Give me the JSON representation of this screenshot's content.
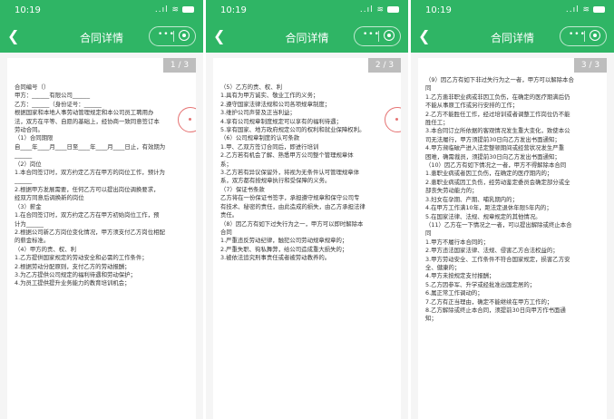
{
  "phones": [
    {
      "time": "10:19",
      "signal": "..ıl",
      "title": "合同详情",
      "capsule_dots": "•••",
      "pager": "1 / 3",
      "lines": [
        "",
        "合同编号（）",
        "甲方：______有限公司______",
        "乙方：______（身份证号：______",
        "根据国家和本地人事劳动管理规定和本公司员工聘用办",
        "法，双方在平等、自愿的基础上，经协商一致同意签订本",
        "劳动合同。",
        "（1）合同期限",
        "自____年____月____日至____年____月____日止，有效期为",
        "______",
        "（2）岗位",
        "1.本合同签订时，双方约定乙方在甲方的岗位工作，预计为",
        "______",
        "2.根据甲方发展需要，任何乙方可以提出岗位调换要求，",
        "经双方同意后调换新的岗位",
        "（3）薪金",
        "1.在合同签订时，双方约定乙方在甲方初始岗位工作，预",
        "计为______",
        "2.根据公司新乙方岗位变化情况，甲方须支付乙方岗位相配",
        "的薪金标准。",
        "（4）甲方的责、权、利",
        "1.乙方提供国家规定的劳动安全和必需的工作条件；",
        "2.根据劳动分配原则，支付乙方的劳动报酬；",
        "3.为乙方提供公司规定的福利待遇和劳动保护；",
        "4.为员工提供提升业务能力的教育培训机会；"
      ]
    },
    {
      "time": "10:19",
      "signal": "..ıl",
      "title": "合同详情",
      "capsule_dots": "•••",
      "pager": "2 / 3",
      "lines": [
        "",
        "（5）乙方的责、权、利",
        "1.具有为甲方诚实、敬业工作的义务；",
        "2.遵守国家法律法规和公司各项规章制度；",
        "3.维护公司声誉及正当利益；",
        "4.享有公司规章制度规定可以享有的福利待遇；",
        "5.享有国家、地方政府规定公司的权利和就业保障权利。",
        "（6）公司规章制度的认可条款",
        "1.甲、乙双方签订合同后，即进行培训",
        "2.乙方若有机会了解、熟悉甲方公司整个管理规章体",
        "系；",
        "3.乙方若有异议保留外，将视为无条件认可管理规章体",
        "系，双方都有按规章执行和受保障的义务。",
        "（7）保证书条款",
        "乙方将在一份保证书签字，承担遵守规章和保守公司专",
        "有技术、秘密的责任，由此造成的损失，由乙方承担法律",
        "责任。",
        "（8）因乙方有如下过失行为之一，甲方可以即时解除本",
        "合同",
        "1.严重违反劳动纪律，触犯公司劳动规章规章的；",
        "2.严重失职、徇私舞弊，给公司造成重大损失的；",
        "3.被依法追究刑事责任或者被劳动教养的。"
      ]
    },
    {
      "time": "10:19",
      "signal": "..ıl",
      "title": "合同详情",
      "capsule_dots": "•••",
      "pager": "3 / 3",
      "lines": [
        "（9）因乙方有如下非过失行为之一者，甲方可以解除本合",
        "同",
        "1.乙方患非职业病或非因工负伤，在确定的医疗期满后仍",
        "不能从事原工作或另行安排的工作；",
        "2.乙方不能胜任工作，经过培训或者调整工作岗位仍不能",
        "胜任工；",
        "3.本合同订立所依据的客观情况发生重大变化，致使本公",
        "司无法履行，甲方须提前30日向乙方发出书面通知；",
        "4.甲方濒临破产进入法定整顿期间或经营状况发生严重",
        "困难，确需裁员，须提前30日向乙方发出书面通知；",
        "（10）因乙方有如下情况之一者，甲方不得解除本合同",
        "1.患职业病或者因工负伤，在确定的医疗期内的；",
        "2.患职业病或因工负伤，经劳动鉴定委员会确定部分或全",
        "部丧失劳动能力的；",
        "3.妇女在孕期、产期、哺乳期内的；",
        "4.在甲方工作满10年，距法定退休年限5年内的；",
        "5.在国家法律、法规、规章规定的其他情况。",
        "（11）乙方在一下情况之一者，可以提出解除或终止本合",
        "同",
        "1.甲方不履行本合同的；",
        "2.甲方违法国家法律、法规、侵害乙方合法权益的；",
        "3.甲方劳动安全、工作条件不符合国家规定，损害乙方安",
        "全、健康的；",
        "4.甲方未按规定支付报酬；",
        "5.乙方因参军、升学或经批准出国定居的；",
        "6.属正常工作调动的；",
        "7.乙方有正当理由，确定不能继续在甲方工作的；",
        "8.乙方解除或终止本合同，须提前30日向甲方作书面通",
        "知；"
      ]
    }
  ],
  "colors": {
    "header_green": "#2fb565",
    "page_bg": "#f5f5f5",
    "pager_bg": "#bdbdbd",
    "stamp": "#e57373"
  }
}
